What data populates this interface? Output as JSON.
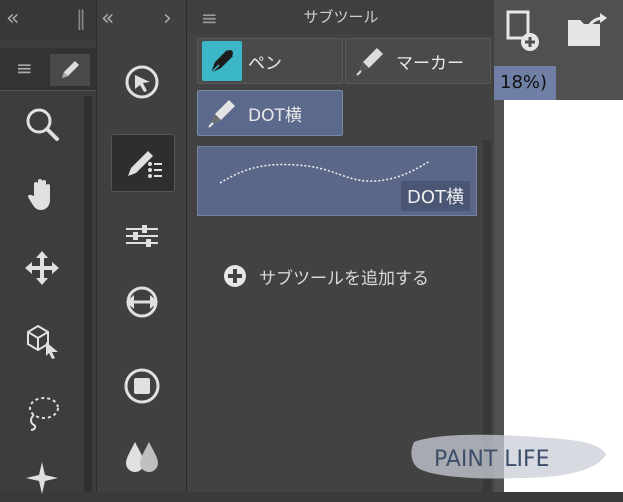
{
  "left_column": {
    "collapse_glyph": "«",
    "grip_glyph": "‖",
    "menu_glyph": "≡",
    "tools": [
      {
        "name": "zoom-tool",
        "icon": "magnifier-icon"
      },
      {
        "name": "hand-tool",
        "icon": "hand-icon"
      },
      {
        "name": "move-tool",
        "icon": "move-arrows-icon"
      },
      {
        "name": "object-tool",
        "icon": "object-cube-cursor-icon"
      },
      {
        "name": "lasso-tool",
        "icon": "lasso-icon"
      },
      {
        "name": "sparkle-tool",
        "icon": "sparkle-icon"
      }
    ]
  },
  "second_column": {
    "collapse_glyph": "«",
    "expand_glyph": "›",
    "tools": [
      {
        "name": "rotate-tool",
        "icon": "rotate-cursor-icon"
      },
      {
        "name": "subtool-pen-group",
        "icon": "pen-list-icon",
        "active": true
      },
      {
        "name": "tool-property-button",
        "icon": "sliders-icon"
      },
      {
        "name": "transform-button",
        "icon": "swap-arrows-icon"
      },
      {
        "name": "fill-tool",
        "icon": "fill-square-icon"
      },
      {
        "name": "color-tool",
        "icon": "drops-icon"
      }
    ]
  },
  "subtool_panel": {
    "menu_glyph": "≡",
    "title": "サブツール",
    "groups": [
      {
        "label": "ペン",
        "icon": "pen-nib-icon",
        "selected": false
      },
      {
        "label": "マーカー",
        "icon": "marker-icon",
        "selected": false
      },
      {
        "label": "DOT横",
        "icon": "marker-icon",
        "selected": true
      }
    ],
    "preset_name": "DOT横",
    "add_subtool_label": "サブツールを追加する"
  },
  "right_area": {
    "zoom_text": "18%)",
    "logo_text": "PAINT LIFE"
  },
  "colors": {
    "accent": "#5b6a8c",
    "pen_icon_bg": "#3bb7c8"
  }
}
